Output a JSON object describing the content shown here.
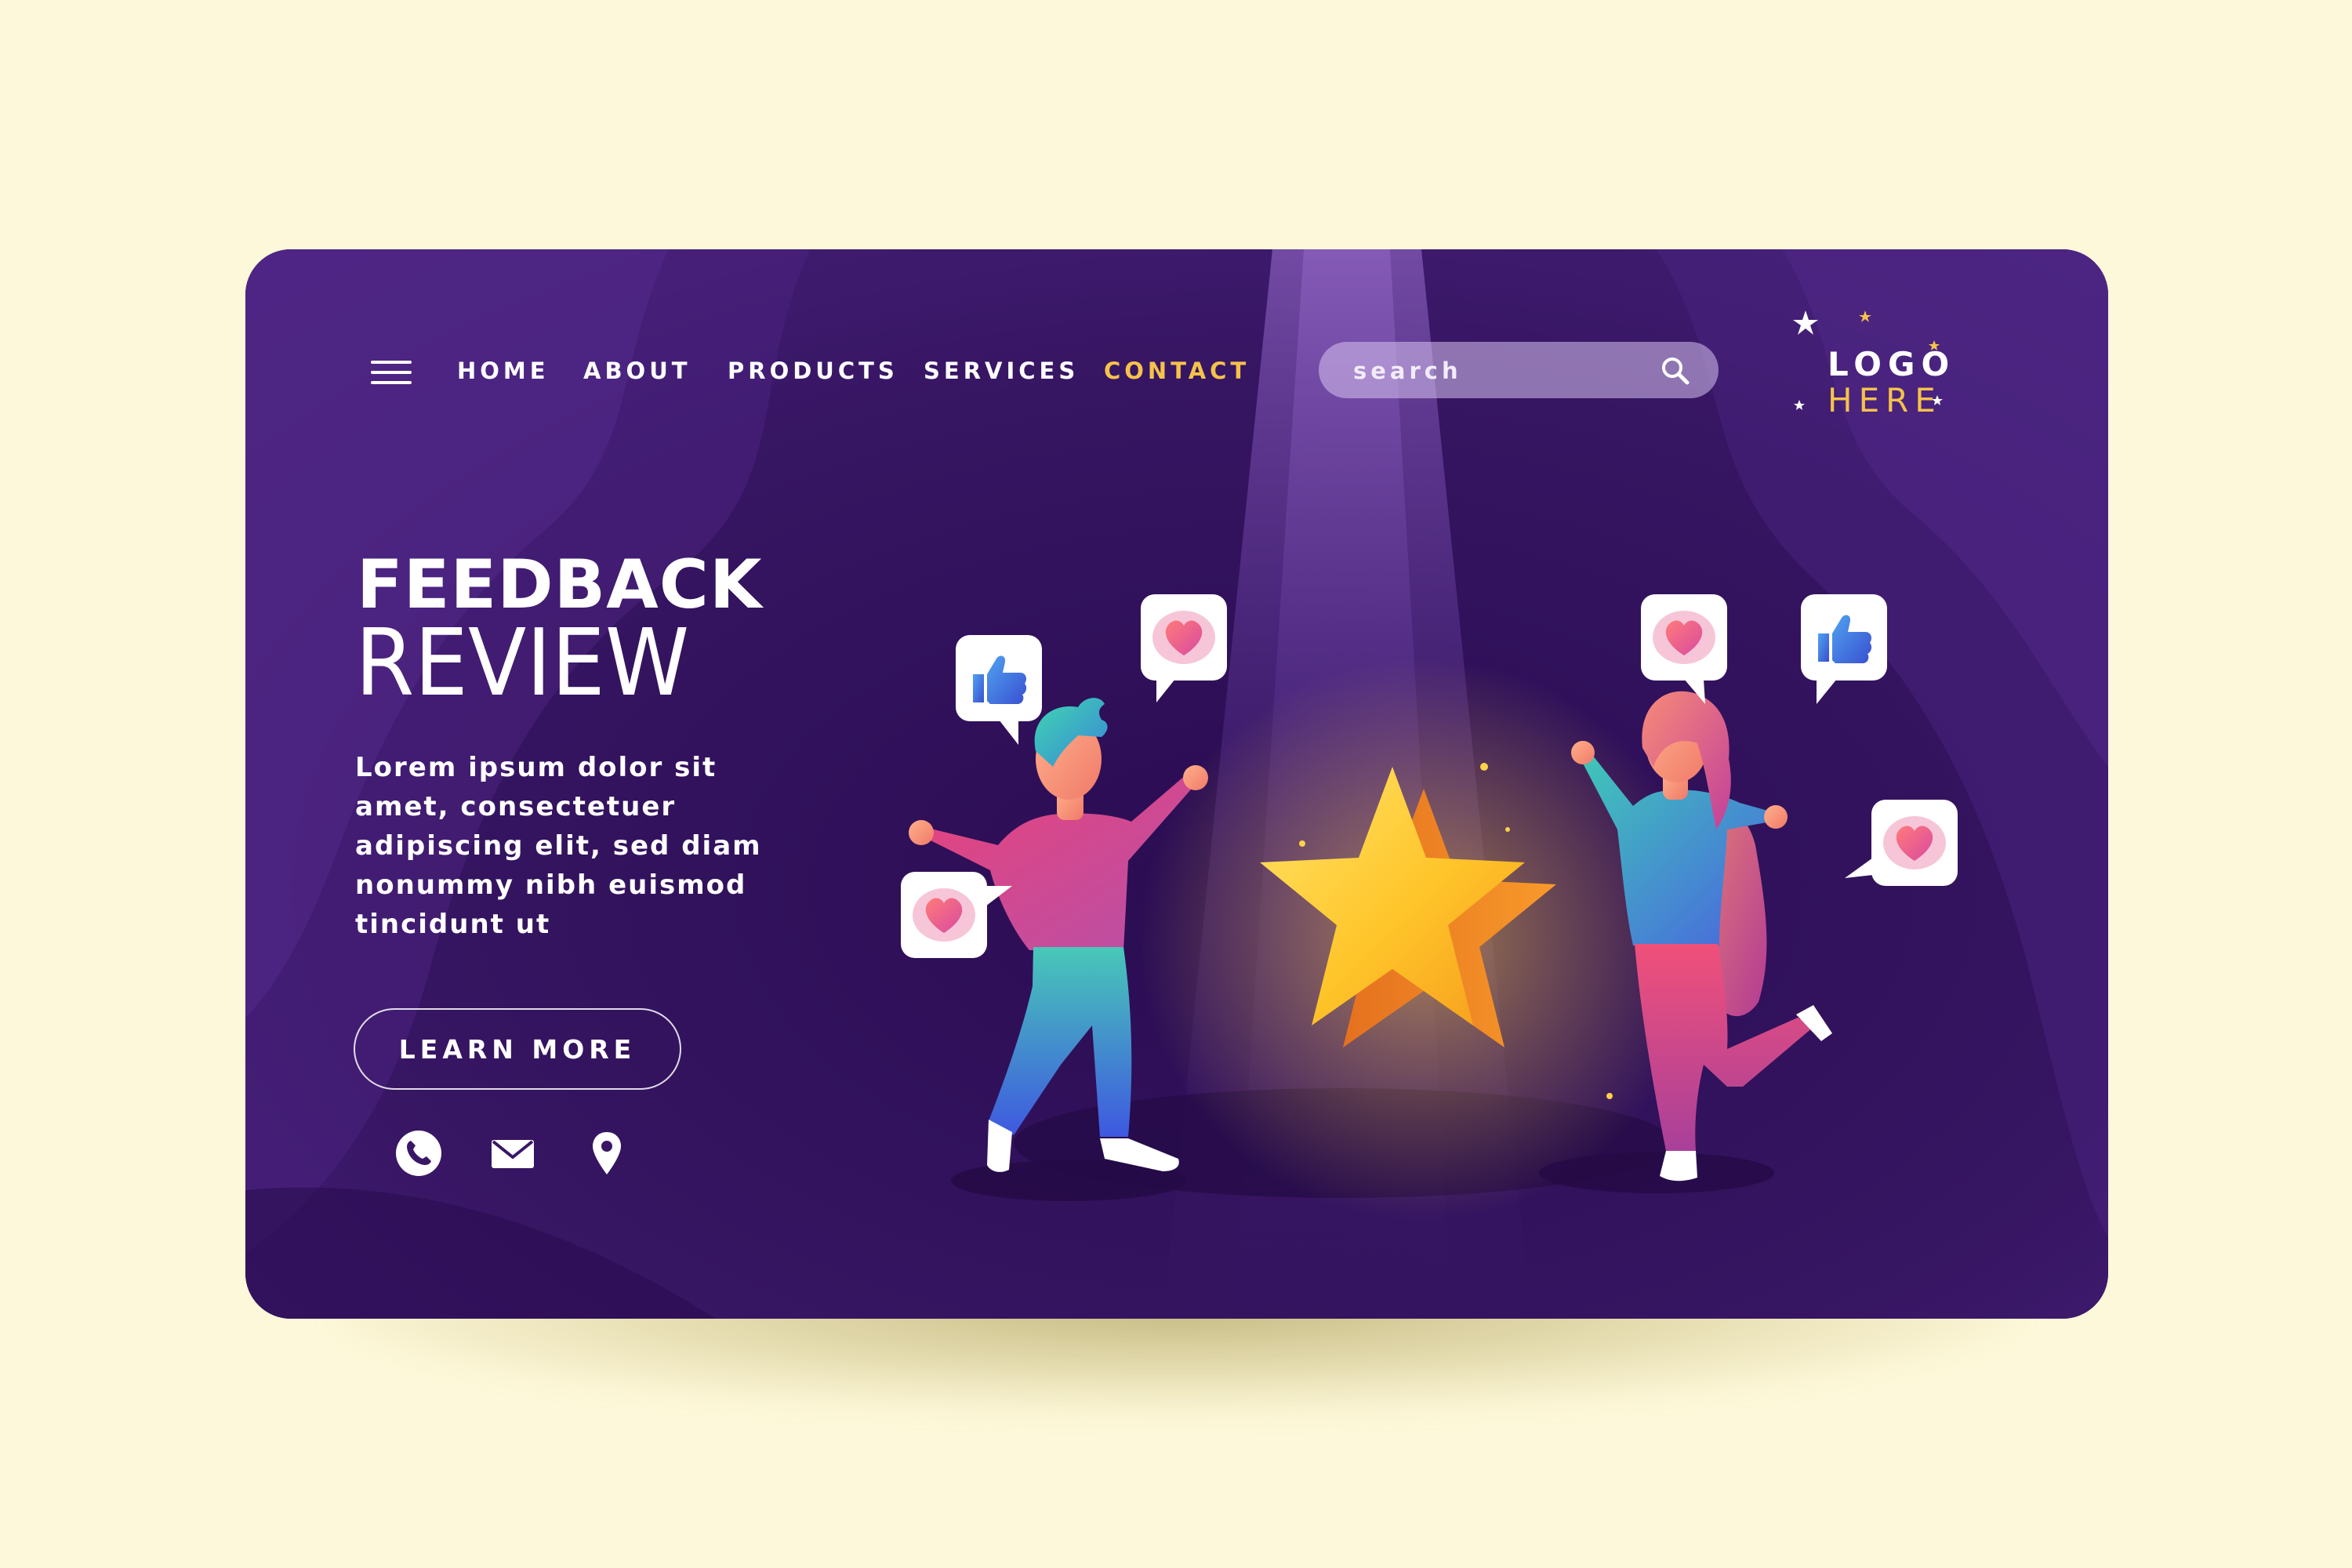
{
  "nav": {
    "items": [
      {
        "label": "HOME"
      },
      {
        "label": "ABOUT"
      },
      {
        "label": "PRODUCTS"
      },
      {
        "label": "SERVICES"
      },
      {
        "label": "CONTACT"
      }
    ],
    "active_index": 4
  },
  "search": {
    "placeholder": "search"
  },
  "logo": {
    "line1": "LOGO",
    "line2": "HERE"
  },
  "hero": {
    "title_line1": "FEEDBACK",
    "title_line2": "REVIEW",
    "body": "Lorem ipsum dolor sit amet, consectetuer adipiscing elit, sed diam nonummy nibh euismod tincidunt ut",
    "cta_label": "LEARN MORE"
  },
  "contact_icons": [
    "phone-icon",
    "mail-icon",
    "location-pin-icon"
  ],
  "reactions": [
    "thumbs-up-icon",
    "heart-icon"
  ],
  "colors": {
    "background": "#fdf8d9",
    "card": "#3a1668",
    "accent": "#f5c24a",
    "text": "#ffffff",
    "star": "#ffc52a",
    "thumbs_up": "#3f6fe0",
    "heart": "#f0607a"
  }
}
